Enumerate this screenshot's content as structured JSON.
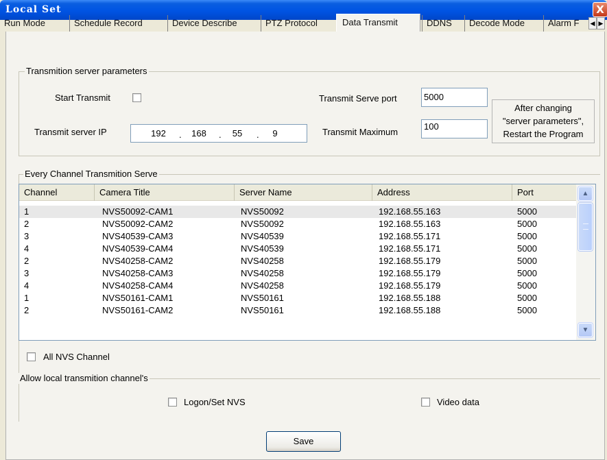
{
  "window": {
    "title": "Local Set",
    "close_glyph": "X"
  },
  "tabs": [
    {
      "label": "Run Mode"
    },
    {
      "label": "Schedule Record"
    },
    {
      "label": "Device Describe"
    },
    {
      "label": "PTZ Protocol"
    },
    {
      "label": "Data Transmit",
      "active": true
    },
    {
      "label": "DDNS"
    },
    {
      "label": "Decode Mode"
    },
    {
      "label": "Alarm F"
    }
  ],
  "server_params": {
    "title": "Transmition  server parameters",
    "start_transmit_label": "Start Transmit",
    "start_transmit_checked": false,
    "server_ip_label": "Transmit server IP",
    "server_ip": [
      "192",
      "168",
      "55",
      "9"
    ],
    "serve_port_label": "Transmit Serve port",
    "serve_port": "5000",
    "maximum_label": "Transmit Maximum",
    "maximum": "100",
    "note_lines": [
      "After changing",
      "\"server parameters\",",
      "Restart the Program"
    ]
  },
  "channels": {
    "title": "Every Channel Transmition Serve",
    "columns": [
      "Channel",
      "Camera Title",
      "Server Name",
      "Address",
      "Port"
    ],
    "rows": [
      [
        "1",
        "NVS50092-CAM1",
        "NVS50092",
        "192.168.55.163",
        "5000"
      ],
      [
        "2",
        "NVS50092-CAM2",
        "NVS50092",
        "192.168.55.163",
        "5000"
      ],
      [
        "3",
        "NVS40539-CAM3",
        "NVS40539",
        "192.168.55.171",
        "5000"
      ],
      [
        "4",
        "NVS40539-CAM4",
        "NVS40539",
        "192.168.55.171",
        "5000"
      ],
      [
        "2",
        "NVS40258-CAM2",
        "NVS40258",
        "192.168.55.179",
        "5000"
      ],
      [
        "3",
        "NVS40258-CAM3",
        "NVS40258",
        "192.168.55.179",
        "5000"
      ],
      [
        "4",
        "NVS40258-CAM4",
        "NVS40258",
        "192.168.55.179",
        "5000"
      ],
      [
        "1",
        "NVS50161-CAM1",
        "NVS50161",
        "192.168.55.188",
        "5000"
      ],
      [
        "2",
        "NVS50161-CAM2",
        "NVS50161",
        "192.168.55.188",
        "5000"
      ]
    ],
    "all_nvs_label": "All NVS Channel",
    "all_nvs_checked": false
  },
  "allow_local": {
    "title": "Allow local transmition channel's",
    "logon_label": "Logon/Set NVS",
    "logon_checked": false,
    "video_label": "Video data",
    "video_checked": false
  },
  "save_label": "Save"
}
